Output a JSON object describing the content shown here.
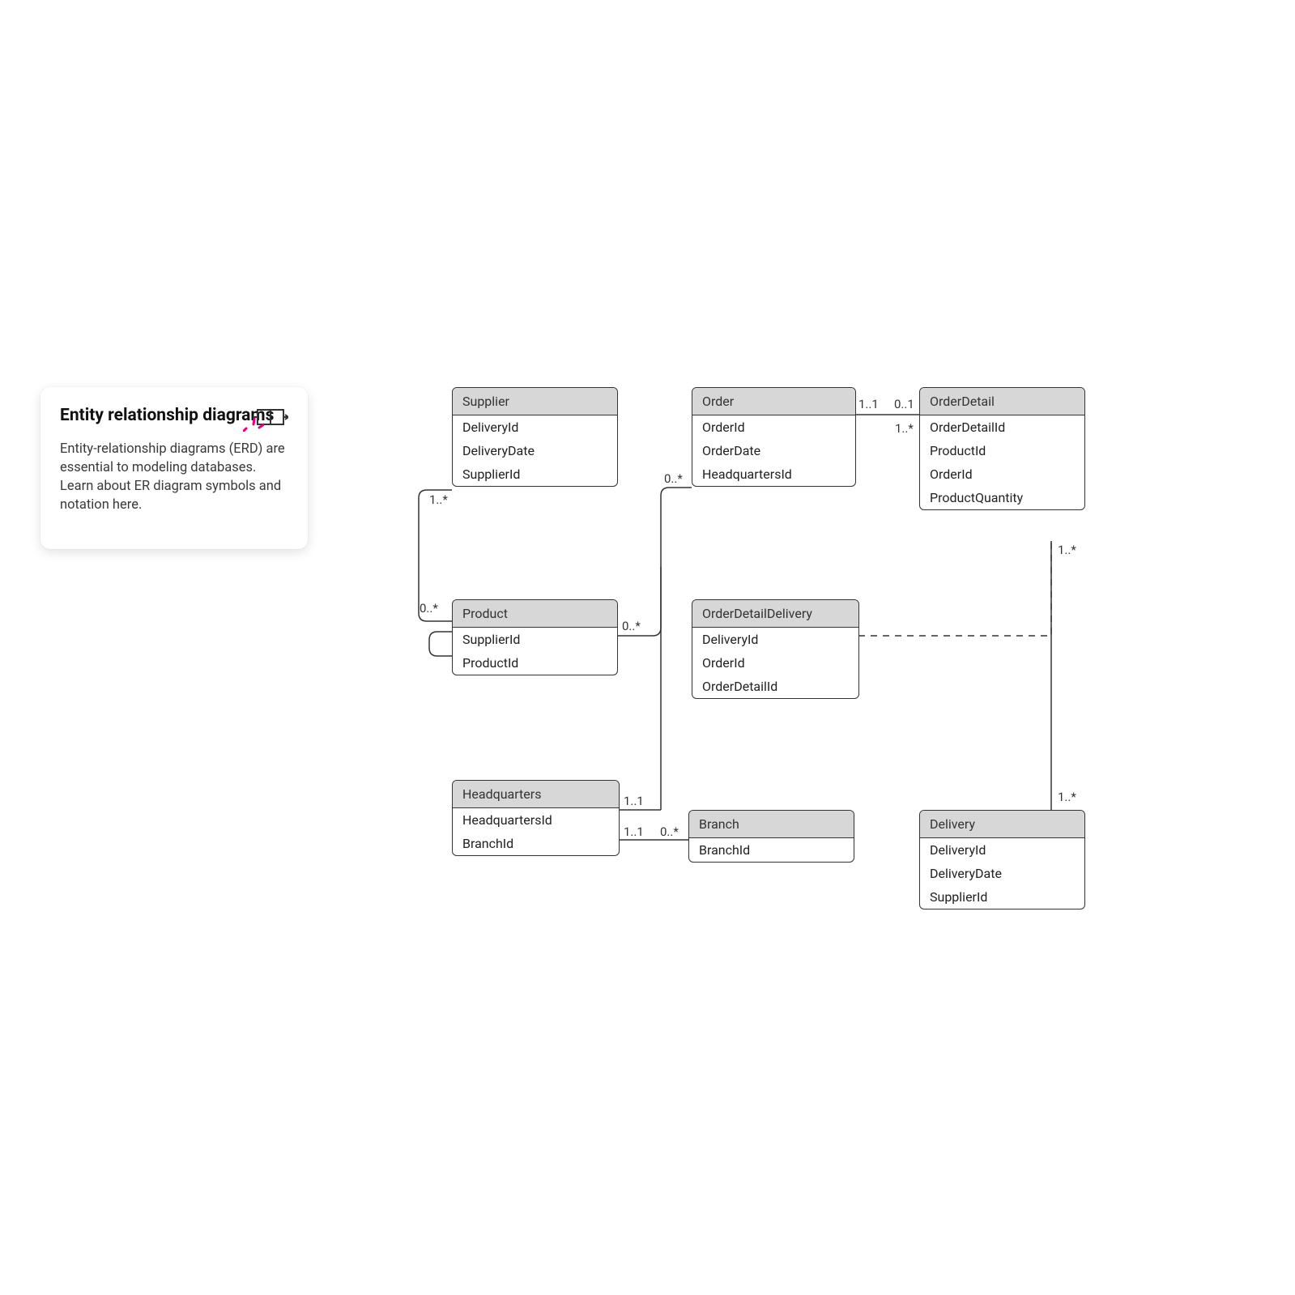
{
  "card": {
    "title": "Entity relationship diagrams",
    "body": "Entity-relationship diagrams (ERD) are essential to modeling databases. Learn about ER diagram symbols and notation here."
  },
  "tables": {
    "supplier": {
      "name": "Supplier",
      "attrs": [
        "DeliveryId",
        "DeliveryDate",
        "SupplierId"
      ]
    },
    "product": {
      "name": "Product",
      "attrs": [
        "SupplierId",
        "ProductId"
      ]
    },
    "headquarters": {
      "name": "Headquarters",
      "attrs": [
        "HeadquartersId",
        "BranchId"
      ]
    },
    "order": {
      "name": "Order",
      "attrs": [
        "OrderId",
        "OrderDate",
        "HeadquartersId"
      ]
    },
    "orderDetailDelivery": {
      "name": "OrderDetailDelivery",
      "attrs": [
        "DeliveryId",
        "OrderId",
        "OrderDetailId"
      ]
    },
    "branch": {
      "name": "Branch",
      "attrs": [
        "BranchId"
      ]
    },
    "orderDetail": {
      "name": "OrderDetail",
      "attrs": [
        "OrderDetailId",
        "ProductId",
        "OrderId",
        "ProductQuantity"
      ]
    },
    "delivery": {
      "name": "Delivery",
      "attrs": [
        "DeliveryId",
        "DeliveryDate",
        "SupplierId"
      ]
    }
  },
  "cardinality": {
    "supplier_product_top": "1..*",
    "supplier_product_bot": "0..*",
    "product_order_left": "0..*",
    "product_order_top": "0..*",
    "hq_order": "1..1",
    "hq_branch_left": "1..1",
    "hq_branch_right": "0..*",
    "order_orderdetail_left": "1..1",
    "order_orderdetail_right": "0..1",
    "orderdetail_odd": "1..*",
    "orderdetail_delivery_top": "1..*",
    "orderdetail_delivery_bot": "1..*"
  }
}
